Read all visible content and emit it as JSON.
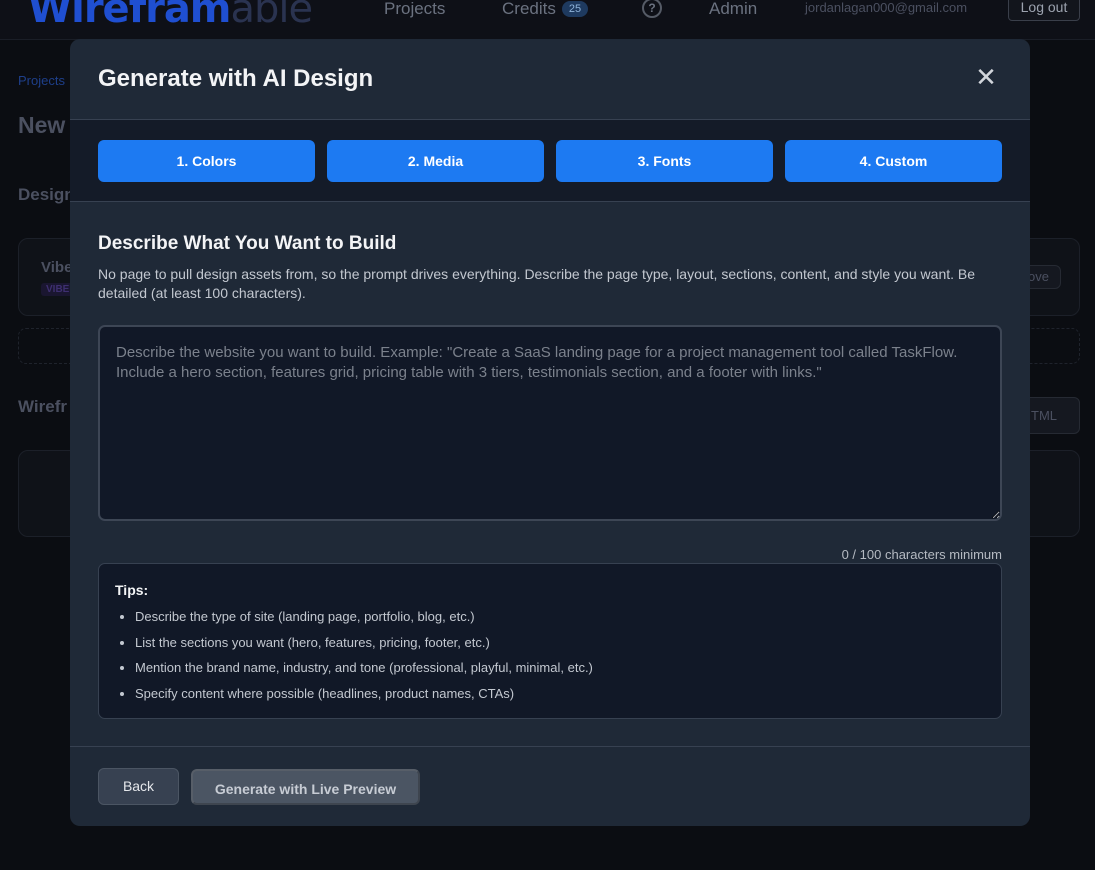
{
  "app": {
    "logo_part1": "Wirefram",
    "logo_part2": "able",
    "nav": {
      "projects": "Projects",
      "credits": "Credits",
      "credits_count": "25",
      "admin": "Admin",
      "help_icon": "?",
      "user_email": "jordanlagan000@gmail.com",
      "logout": "Log out"
    },
    "background": {
      "breadcrumb": "Projects",
      "page_title": "New",
      "section_design": "Design",
      "card_title": "Vibe",
      "card_badge": "VIBE",
      "card_action": "ove",
      "section_wireframe": "Wirefr",
      "html_button": "TML"
    }
  },
  "modal": {
    "title": "Generate with AI Design",
    "close_icon": "✕",
    "steps": [
      {
        "label": "1. Colors"
      },
      {
        "label": "2. Media"
      },
      {
        "label": "3. Fonts"
      },
      {
        "label": "4. Custom"
      }
    ],
    "body": {
      "heading": "Describe What You Want to Build",
      "description": "No page to pull design assets from, so the prompt drives everything. Describe the page type, layout, sections, content, and style you want. Be detailed (at least 100 characters).",
      "prompt": {
        "value": "",
        "placeholder": "Describe the website you want to build. Example: \"Create a SaaS landing page for a project management tool called TaskFlow. Include a hero section, features grid, pricing table with 3 tiers, testimonials section, and a footer with links.\""
      },
      "char_count": "0 / 100 characters minimum",
      "tips": {
        "title": "Tips:",
        "items": [
          "Describe the type of site (landing page, portfolio, blog, etc.)",
          "List the sections you want (hero, features, pricing, footer, etc.)",
          "Mention the brand name, industry, and tone (professional, playful, minimal, etc.)",
          "Specify content where possible (headlines, product names, CTAs)"
        ]
      }
    },
    "footer": {
      "back": "Back",
      "generate": "Generate with Live Preview"
    }
  },
  "colors": {
    "accent": "#1d7af2",
    "modal_bg": "#1f2937",
    "page_bg": "#0b0d12"
  }
}
